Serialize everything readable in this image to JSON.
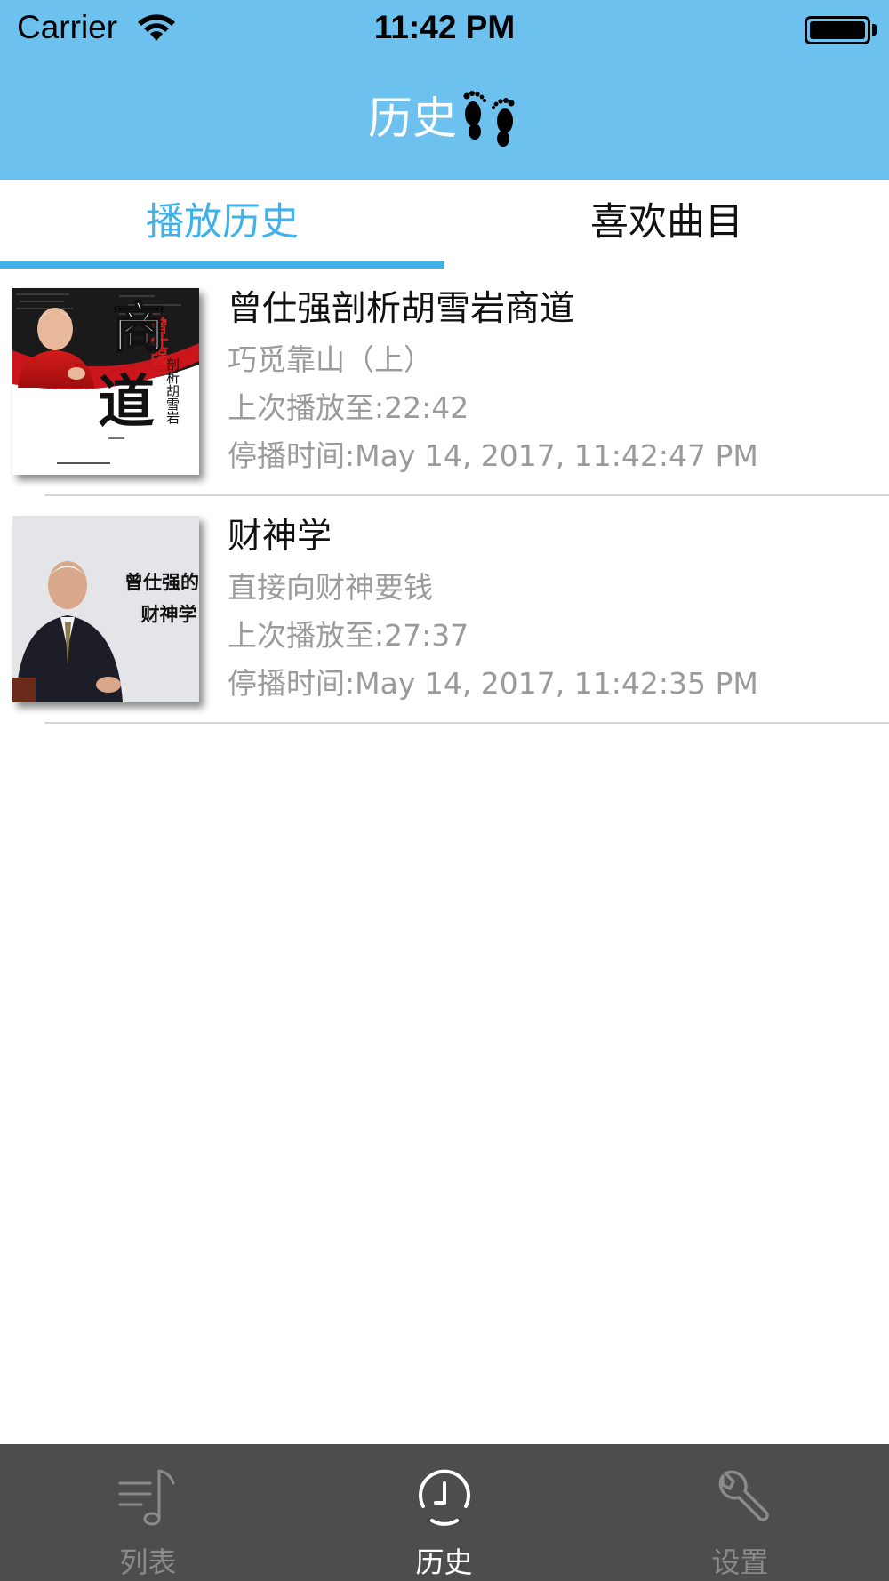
{
  "status_bar": {
    "carrier": "Carrier",
    "time": "11:42 PM"
  },
  "nav": {
    "title": "历史",
    "title_icon": "footprints-icon",
    "background_color": "#6dc1ef"
  },
  "tabs": {
    "active": "播放历史",
    "inactive": "喜欢曲目",
    "accent_color": "#3fb2ea"
  },
  "history": [
    {
      "title": "曾仕强剖析胡雪岩商道",
      "episode": "巧觅靠山（上）",
      "last_position": "上次播放至:22:42",
      "stopped_at": "停播时间:May 14, 2017, 11:42:47 PM",
      "cover": {
        "author": "曾仕强",
        "main_chars": "商道",
        "subtitle": "剖析胡雪岩"
      }
    },
    {
      "title": "财神学",
      "episode": "直接向财神要钱",
      "last_position": "上次播放至:27:37",
      "stopped_at": "停播时间:May 14, 2017, 11:42:35 PM",
      "cover": {
        "line1": "曾仕强的",
        "line2": "财神学"
      }
    }
  ],
  "tabbar": {
    "items": [
      {
        "label": "列表",
        "icon": "music-list-icon",
        "selected": false
      },
      {
        "label": "历史",
        "icon": "clock-icon",
        "selected": true
      },
      {
        "label": "设置",
        "icon": "wrench-icon",
        "selected": false
      }
    ],
    "background_color": "#4d4d4d"
  }
}
